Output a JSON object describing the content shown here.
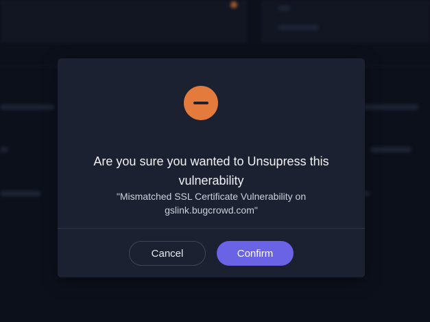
{
  "dialog": {
    "title": "Are you sure you wanted to Unsupress this vulnerability",
    "subtitle": "\"Mismatched SSL Certificate Vulnerability on gslink.bugcrowd.com\"",
    "icon": "minus-circle-icon",
    "icon_color": "#e57a3d",
    "cancel_label": "Cancel",
    "confirm_label": "Confirm",
    "confirm_color": "#6b63e6"
  }
}
